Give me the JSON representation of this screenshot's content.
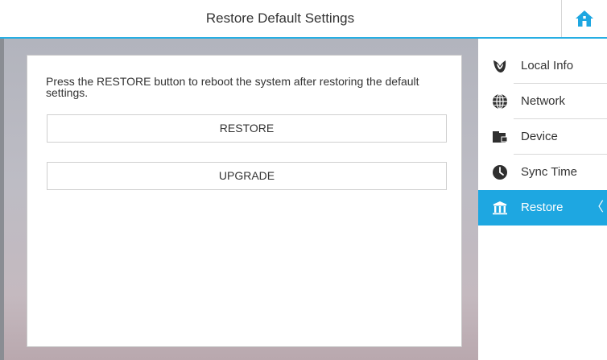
{
  "header": {
    "title": "Restore Default Settings",
    "home_icon": "home-icon",
    "accent_color": "#27aee3"
  },
  "main": {
    "description": "Press the RESTORE button to reboot the system after restoring the default settings.",
    "buttons": {
      "restore_label": "RESTORE",
      "upgrade_label": "UPGRADE"
    }
  },
  "sidebar": {
    "items": [
      {
        "label": "Local Info",
        "icon": "local-info-icon",
        "active": false
      },
      {
        "label": "Network",
        "icon": "globe-icon",
        "active": false
      },
      {
        "label": "Device",
        "icon": "device-icon",
        "active": false
      },
      {
        "label": "Sync Time",
        "icon": "clock-icon",
        "active": false
      },
      {
        "label": "Restore",
        "icon": "restore-icon",
        "active": true
      }
    ],
    "active_color": "#1ea7e1",
    "active_chevron": "〈"
  }
}
